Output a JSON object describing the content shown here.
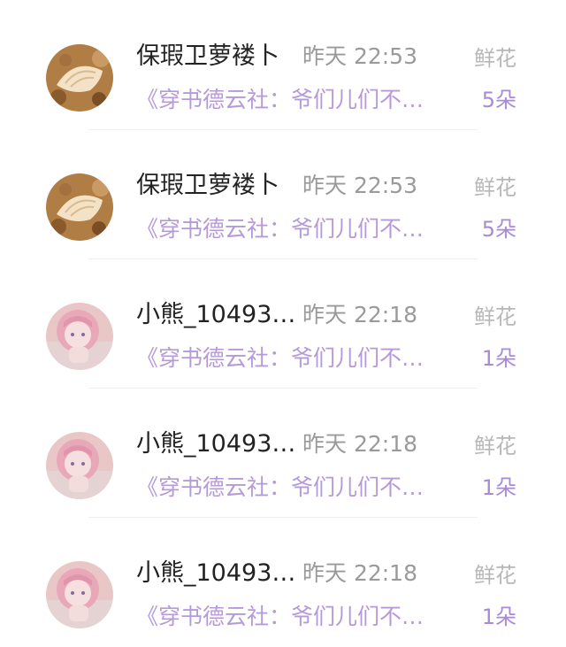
{
  "gift_list": [
    {
      "avatar_icon": "shell-avatar-icon",
      "user_name": "保瑕卫萝褛卜",
      "time": "昨天 22:53",
      "gift_type": "鲜花",
      "book_title": "《穿书德云社：爷们儿们不…",
      "gift_count": "5朵"
    },
    {
      "avatar_icon": "shell-avatar-icon",
      "user_name": "保瑕卫萝褛卜",
      "time": "昨天 22:53",
      "gift_type": "鲜花",
      "book_title": "《穿书德云社：爷们儿们不…",
      "gift_count": "5朵"
    },
    {
      "avatar_icon": "anime-girl-avatar-icon",
      "user_name": "小熊_10493…",
      "time": "昨天 22:18",
      "gift_type": "鲜花",
      "book_title": "《穿书德云社：爷们儿们不…",
      "gift_count": "1朵"
    },
    {
      "avatar_icon": "anime-girl-avatar-icon",
      "user_name": "小熊_10493…",
      "time": "昨天 22:18",
      "gift_type": "鲜花",
      "book_title": "《穿书德云社：爷们儿们不…",
      "gift_count": "1朵"
    },
    {
      "avatar_icon": "anime-girl-avatar-icon",
      "user_name": "小熊_10493…",
      "time": "昨天 22:18",
      "gift_type": "鲜花",
      "book_title": "《穿书德云社：爷们儿们不…",
      "gift_count": "1朵"
    }
  ],
  "colors": {
    "book_title": "#b69ad8",
    "gift_count": "#a68bd8",
    "user_name": "#222222",
    "time": "#9a9a9a",
    "gift_type": "#b7b7b7"
  }
}
